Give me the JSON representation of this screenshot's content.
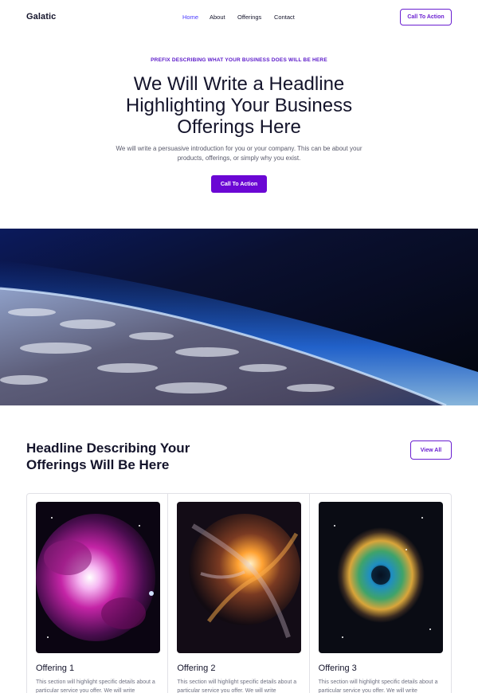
{
  "brand": "Galatic",
  "nav": {
    "items": [
      {
        "label": "Home",
        "active": true
      },
      {
        "label": "About",
        "active": false
      },
      {
        "label": "Offerings",
        "active": false
      },
      {
        "label": "Contact",
        "active": false
      }
    ],
    "cta_label": "Call To Action"
  },
  "hero": {
    "prefix": "PREFIX DESCRIBING WHAT YOUR BUSINESS DOES WILL BE HERE",
    "headline": "We Will Write a Headline Highlighting Your Business Offerings Here",
    "intro": "We will write a persuasive introduction for you or your company. This can be about your products, offerings, or simply why you exist.",
    "cta_label": "Call To Action"
  },
  "offerings": {
    "headline": "Headline Describing Your Offerings Will Be Here",
    "view_all_label": "View All",
    "cards": [
      {
        "title": "Offering 1",
        "description": "This section will highlight specific details about a particular service you offer. We will write",
        "image": "pink-nebula"
      },
      {
        "title": "Offering 2",
        "description": "This section will highlight specific details about a particular service you offer. We will write",
        "image": "orange-galaxy-swirl"
      },
      {
        "title": "Offering 3",
        "description": "This section will highlight specific details about a particular service you offer. We will write",
        "image": "rosette-nebula"
      }
    ]
  },
  "colors": {
    "accent": "#6b07d4",
    "nav_active": "#4a3aff",
    "text": "#14142b",
    "muted": "#595a6b"
  }
}
